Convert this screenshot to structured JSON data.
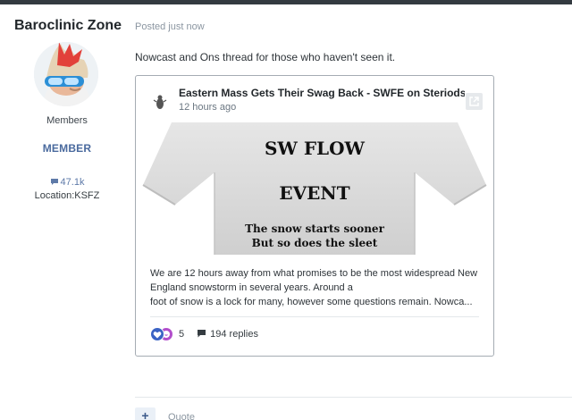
{
  "author": {
    "name": "Baroclinic Zone",
    "group": "Members",
    "badge": "MEMBER",
    "post_count": "47.1k",
    "location": "Location:KSFZ"
  },
  "post": {
    "meta": "Posted just now",
    "text": "Nowcast and Ons thread for those who haven't seen it."
  },
  "embed": {
    "title": "Eastern Mass Gets Their Swag Back - SWFE on Steriods...",
    "time": "12 hours ago",
    "image_lines": [
      "SW FLOW",
      "EVENT",
      "The snow starts sooner",
      "But so does the sleet"
    ],
    "body_lines": [
      "We are 12 hours away from what promises to be the most widespread New",
      "England snowstorm in several years. Around a",
      "foot of snow is a lock for many, however some questions remain. Nowca..."
    ],
    "reaction_count": "5",
    "replies": "194 replies"
  },
  "actions": {
    "add": "+",
    "quote": "Quote"
  },
  "colors": {
    "accent": "#4a6a9e",
    "like": "#3b63c4",
    "haha": "#b24ecb",
    "topbar": "#333a40"
  },
  "icons": [
    "comment-icon",
    "open-link-icon",
    "like-reaction-icon",
    "haha-reaction-icon",
    "replies-icon",
    "favicon-icon"
  ]
}
